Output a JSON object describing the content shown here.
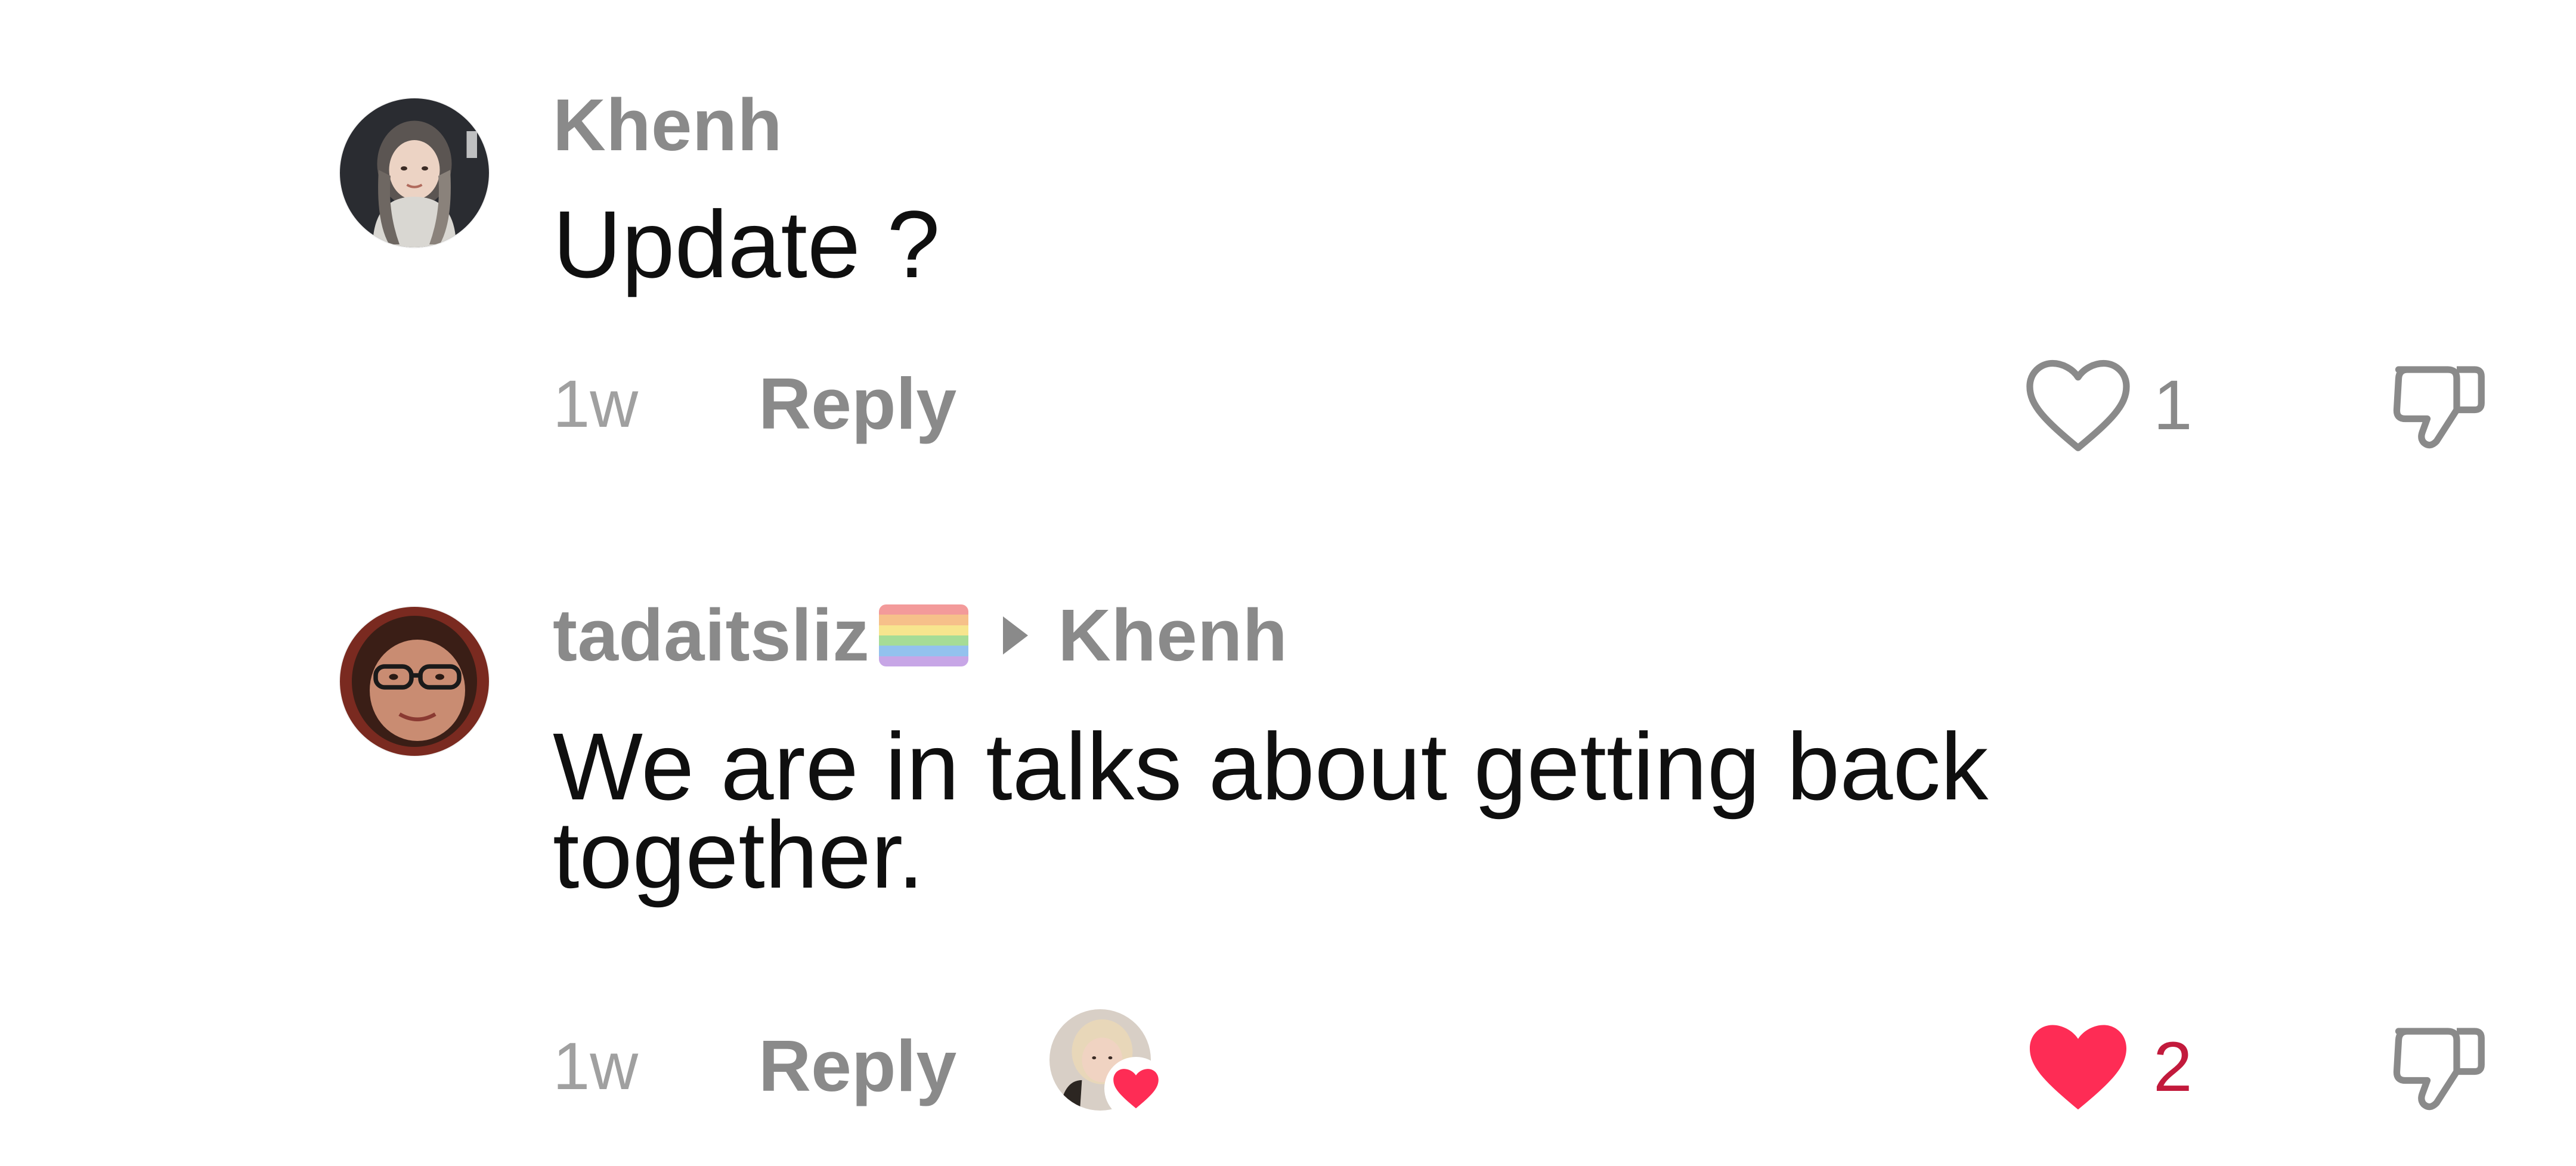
{
  "comments": [
    {
      "username": "Khenh",
      "text": "Update ?",
      "timestamp": "1w",
      "reply_label": "Reply",
      "like_count": "1",
      "liked": false,
      "avatar_icon": "user-avatar-icon"
    },
    {
      "username": "tadaitsliz",
      "username_emoji": "rainbow-flag-icon",
      "reply_to": "Khenh",
      "text_line_1": "We are in talks about getting back",
      "text_line_2": "together.",
      "timestamp": "1w",
      "reply_label": "Reply",
      "like_count": "2",
      "liked": true,
      "creator_liked": true,
      "avatar_icon": "user-avatar-icon"
    }
  ],
  "colors": {
    "username_gray": "#8a8a8a",
    "timestamp_gray": "#a0a0a0",
    "liked_red": "#fe2c55",
    "liked_count_red": "#c21a3c",
    "text": "#0f0f0f"
  }
}
